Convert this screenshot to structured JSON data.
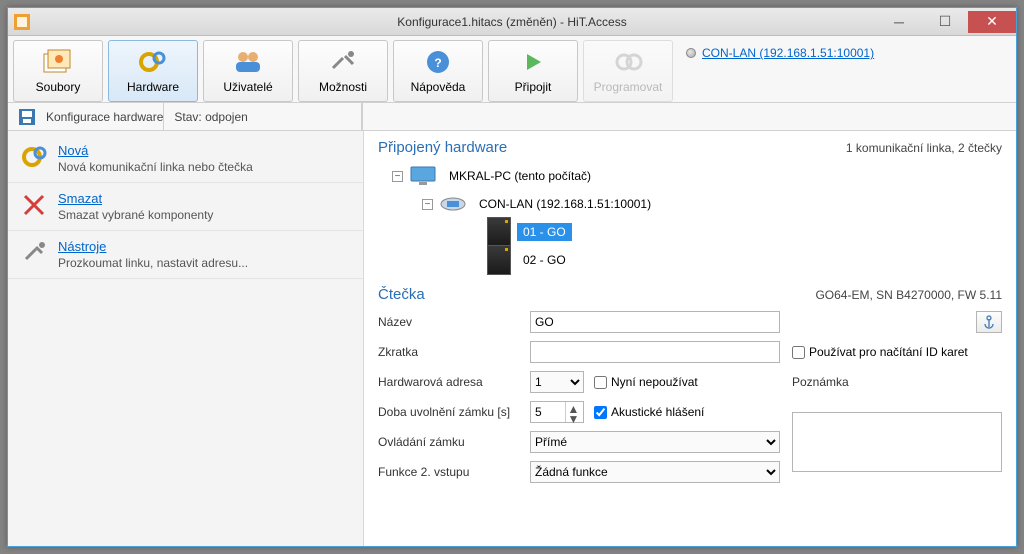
{
  "window": {
    "title": "Konfigurace1.hitacs (změněn) - HiT.Access"
  },
  "toolbar": {
    "soubory": "Soubory",
    "hardware": "Hardware",
    "uzivatele": "Uživatelé",
    "moznosti": "Možnosti",
    "napoveda": "Nápověda",
    "pripojit": "Připojit",
    "programovat": "Programovat"
  },
  "top_link": "CON-LAN (192.168.1.51:10001)",
  "subbar": {
    "label": "Konfigurace hardware",
    "state": "Stav: odpojen"
  },
  "sidebar": {
    "nova": {
      "title": "Nová",
      "desc": "Nová komunikační linka nebo čtečka"
    },
    "smazat": {
      "title": "Smazat",
      "desc": "Smazat vybrané komponenty"
    },
    "nastroje": {
      "title": "Nástroje",
      "desc": "Prozkoumat linku, nastavit adresu..."
    }
  },
  "hw_section": {
    "title": "Připojený hardware",
    "summary": "1 komunikační linka, 2 čtečky",
    "root": "MKRAL-PC (tento počítač)",
    "link": "CON-LAN (192.168.1.51:10001)",
    "reader1": "01 - GO",
    "reader2": "02 - GO"
  },
  "reader_section": {
    "title": "Čtečka",
    "info": "GO64-EM, SN B4270000, FW 5.11",
    "labels": {
      "nazev": "Název",
      "zkratka": "Zkratka",
      "hw_addr": "Hardwarová adresa",
      "unlock": "Doba uvolnění zámku [s]",
      "lock_ctrl": "Ovládání zámku",
      "func2": "Funkce 2. vstupu",
      "note": "Poznámka",
      "use_cards": "Používat pro načítání ID karet",
      "now_not_use": "Nyní nepoužívat",
      "acoustic": "Akustické hlášení"
    },
    "values": {
      "nazev": "GO",
      "zkratka": "",
      "hw_addr": "1",
      "unlock": "5",
      "lock_ctrl": "Přímé",
      "func2": "Žádná funkce",
      "use_cards": false,
      "now_not_use": false,
      "acoustic": true
    }
  }
}
